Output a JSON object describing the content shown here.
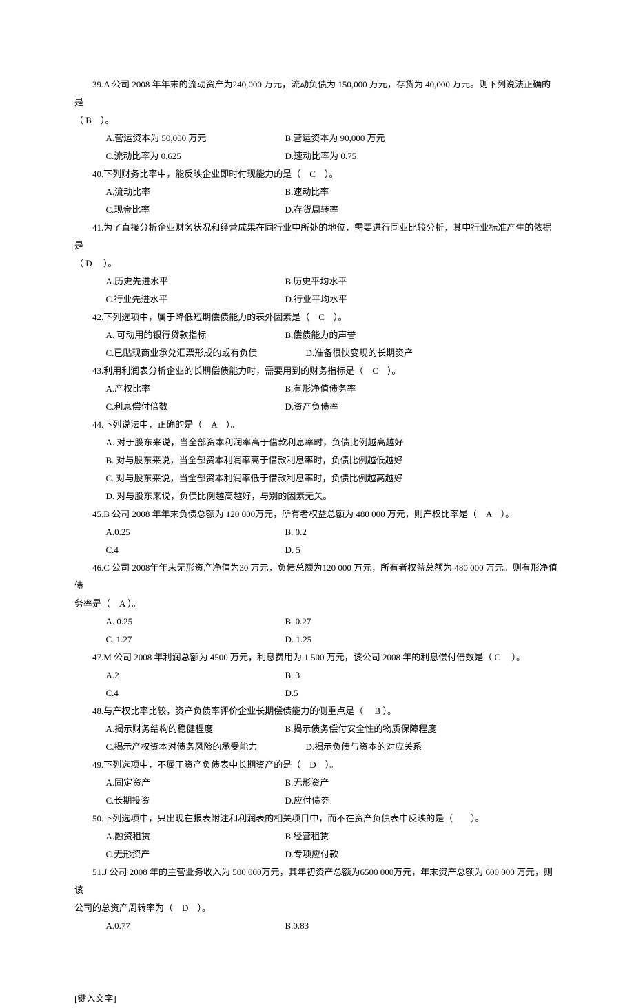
{
  "footer": "[键入文字]",
  "questions": [
    {
      "stem_parts": [
        "39.A 公司 2008 年年末的流动资产为240,000 万元，流动负债为 150,000 万元，存货为 40,000 万元。则下列说法正确的是",
        "（ B　）。"
      ],
      "opts": [
        [
          "A.营运资本为 50,000 万元",
          "B.营运资本为 90,000 万元"
        ],
        [
          "C.流动比率为 0.625",
          "D.速动比率为 0.75"
        ]
      ]
    },
    {
      "stem_parts": [
        "40.下列财务比率中，能反映企业即时付现能力的是（　C　）。"
      ],
      "opts": [
        [
          "A.流动比率",
          "B.速动比率"
        ],
        [
          "C.现金比率",
          "D.存货周转率"
        ]
      ]
    },
    {
      "stem_parts": [
        "41.为了直接分析企业财务状况和经营成果在同行业中所处的地位，需要进行同业比较分析，其中行业标准产生的依据是",
        "（ D　 ）。"
      ],
      "opts": [
        [
          "A.历史先进水平",
          "B.历史平均水平"
        ],
        [
          "C.行业先进水平",
          "D.行业平均水平"
        ]
      ]
    },
    {
      "stem_parts": [
        "42.下列选项中，属于降低短期偿债能力的表外因素是（　C　）。"
      ],
      "opts": [
        [
          "A. 可动用的银行贷款指标",
          "B.偿债能力的声誉"
        ],
        [
          "C.已贴现商业承兑汇票形成的或有负债",
          "D.准备很快变现的长期资产"
        ]
      ]
    },
    {
      "stem_parts": [
        "43.利用利润表分析企业的长期偿债能力时，需要用到的财务指标是（　C　）。"
      ],
      "opts": [
        [
          "A.产权比率",
          "B.有形净值债务率"
        ],
        [
          "C.利息偿付倍数",
          "D.资产负债率"
        ]
      ]
    },
    {
      "stem_parts": [
        "44.下列说法中，正确的是（　A　）。"
      ],
      "full_opts": [
        "A. 对于股东来说，当全部资本利润率高于借款利息率时，负债比例越高越好",
        "B. 对与股东来说，当全部资本利润率高于借款利息率时，负债比例越低越好",
        "C. 对与股东来说，当全部资本利润率低于借款利息率时，负债比例越高越好",
        "D. 对与股东来说，负债比例越高越好，与别的因素无关。"
      ]
    },
    {
      "stem_parts": [
        "45.B 公司 2008 年年末负债总额为 120 000万元，所有者权益总额为 480 000 万元，则产权比率是（　A　）。"
      ],
      "opts": [
        [
          "A.0.25",
          "B. 0.2"
        ],
        [
          "C.4",
          "D. 5"
        ]
      ]
    },
    {
      "stem_parts": [
        "46.C 公司 2008年年末无形资产净值为30 万元，负债总额为120 000 万元，所有者权益总额为 480 000 万元。则有形净值债",
        "务率是（　A ）。"
      ],
      "opts": [
        [
          "A. 0.25",
          "B. 0.27"
        ],
        [
          "C. 1.27",
          "D. 1.25"
        ]
      ]
    },
    {
      "stem_parts": [
        "47.M 公司 2008 年利润总额为 4500 万元，利息费用为 1 500 万元，该公司 2008 年的利息偿付倍数是（ C　 ）。"
      ],
      "opts": [
        [
          "A.2",
          "B. 3"
        ],
        [
          "C.4",
          "D.5"
        ]
      ]
    },
    {
      "stem_parts": [
        "48.与产权比率比较，资产负债率评价企业长期偿债能力的侧重点是（　 B ）。"
      ],
      "opts": [
        [
          "A.揭示财务结构的稳健程度",
          "B.揭示债务偿付安全性的物质保障程度"
        ],
        [
          "C.揭示产权资本对债务风险的承受能力",
          "D.揭示负债与资本的对应关系"
        ]
      ]
    },
    {
      "stem_parts": [
        "49.下列选项中，不属于资产负债表中长期资产的是（　D　）。"
      ],
      "opts": [
        [
          "A.固定资产",
          "B.无形资产"
        ],
        [
          "C.长期投资",
          "D.应付债券"
        ]
      ]
    },
    {
      "stem_parts": [
        "50.下列选项中，只出现在报表附注和利润表的相关项目中，而不在资产负债表中反映的是（　　）。"
      ],
      "opts": [
        [
          "A.融资租赁",
          "B.经营租赁"
        ],
        [
          "C.无形资产",
          "D.专项应付款"
        ]
      ]
    },
    {
      "stem_parts": [
        "51.J 公司 2008 年的主营业务收入为 500 000万元，其年初资产总额为6500 000万元，年末资产总额为 600 000 万元，则该",
        "公司的总资产周转率为（　D　）。"
      ],
      "opts": [
        [
          "A.0.77",
          "B.0.83"
        ]
      ]
    }
  ]
}
